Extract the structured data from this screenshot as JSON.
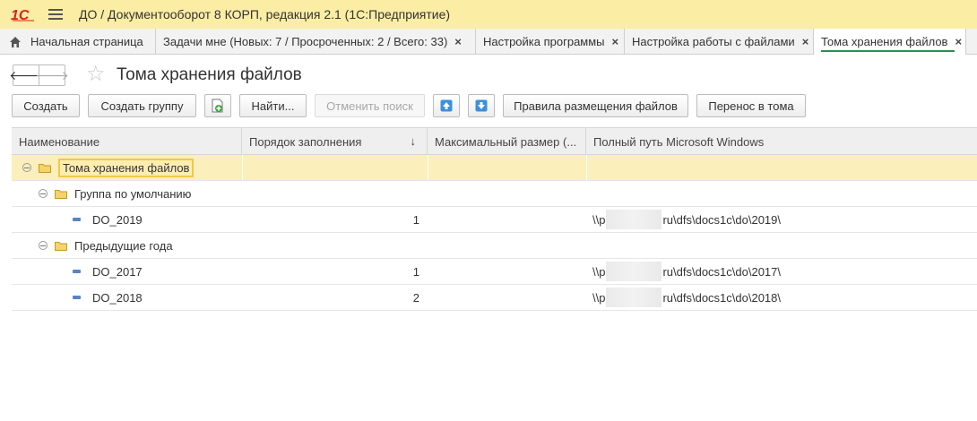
{
  "app": {
    "logo_text": "1С",
    "title": "ДО / Документооборот 8 КОРП, редакция 2.1  (1С:Предприятие)"
  },
  "tabs": [
    {
      "label": "Начальная страница",
      "closable": false,
      "icon": "home-icon"
    },
    {
      "label": "Задачи мне (Новых: 7 / Просроченных: 2 / Всего: 33)",
      "closable": true
    },
    {
      "label": "Настройка программы",
      "closable": true
    },
    {
      "label": "Настройка работы с файлами",
      "closable": true
    },
    {
      "label": "Тома хранения файлов",
      "closable": true,
      "active": true
    }
  ],
  "tab_close_glyph": "×",
  "header": {
    "back_glyph": "🡐",
    "forward_glyph": "🡒",
    "star_glyph": "☆",
    "title": "Тома хранения файлов"
  },
  "toolbar": {
    "create": "Создать",
    "create_group": "Создать группу",
    "find": "Найти...",
    "cancel_search": "Отменить поиск",
    "placement_rules": "Правила размещения файлов",
    "transfer_to_volumes": "Перенос в тома"
  },
  "table": {
    "columns": [
      "Наименование",
      "Порядок заполнения",
      "Максимальный размер (...",
      "Полный путь Microsoft Windows"
    ],
    "sort_glyph": "↓",
    "rows": [
      {
        "type": "root",
        "name": "Тома хранения файлов",
        "order": "",
        "max_size": "",
        "path_prefix": "",
        "path_suffix": "",
        "selected": true
      },
      {
        "type": "group",
        "name": "Группа по умолчанию",
        "order": "",
        "max_size": "",
        "path_prefix": "",
        "path_suffix": ""
      },
      {
        "type": "item",
        "name": "DO_2019",
        "order": "1",
        "max_size": "",
        "path_prefix": "\\\\p",
        "path_suffix": "ru\\dfs\\docs1c\\do\\2019\\"
      },
      {
        "type": "group",
        "name": "Предыдущие года",
        "order": "",
        "max_size": "",
        "path_prefix": "",
        "path_suffix": ""
      },
      {
        "type": "item",
        "name": "DO_2017",
        "order": "1",
        "max_size": "",
        "path_prefix": "\\\\p",
        "path_suffix": "ru\\dfs\\docs1c\\do\\2017\\"
      },
      {
        "type": "item",
        "name": "DO_2018",
        "order": "2",
        "max_size": "",
        "path_prefix": "\\\\p",
        "path_suffix": "ru\\dfs\\docs1c\\do\\2018\\"
      }
    ]
  },
  "colors": {
    "title_bar": "#fbeda3",
    "selection": "#fbefbb",
    "active_tab_underline": "#2f8f4e",
    "logo_red": "#d9241c",
    "arrow_blue": "#3d8fd9"
  }
}
